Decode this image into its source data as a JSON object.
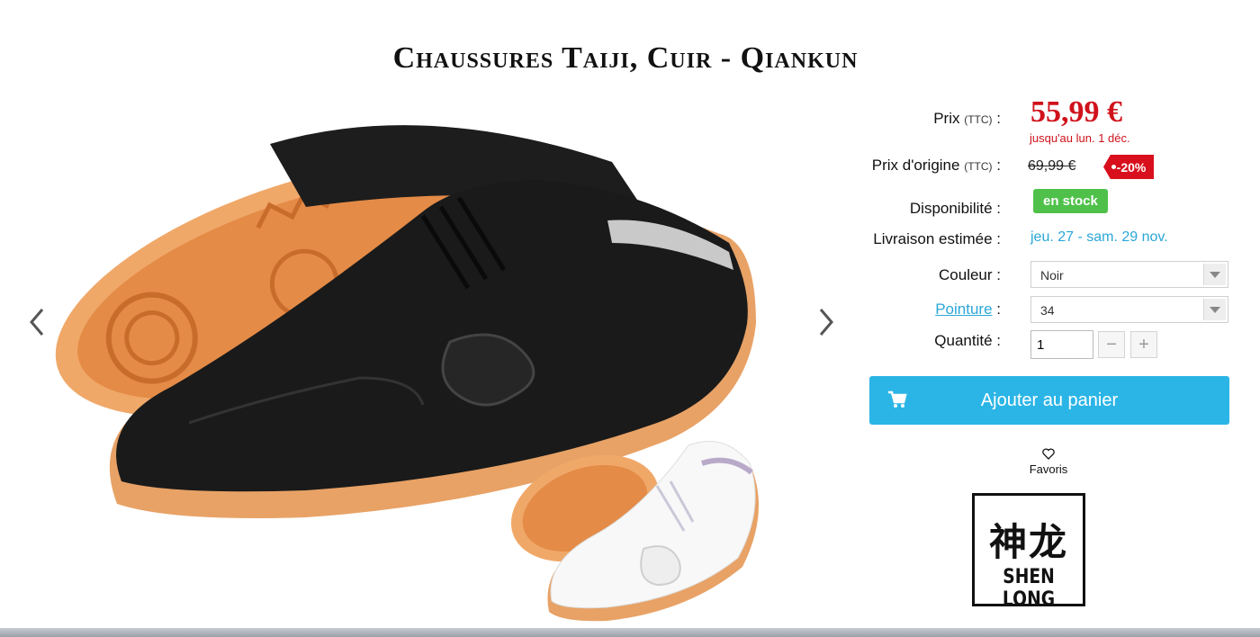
{
  "product": {
    "title": "Chaussures Taiji, Cuir - Qiankun"
  },
  "gallery": {
    "prev_icon": "chevron-left-icon",
    "next_icon": "chevron-right-icon"
  },
  "pricing": {
    "price_label": "Prix",
    "price_tax_note": "(TTC)",
    "price_sep": ":",
    "price": "55,99 €",
    "valid_until": "jusqu'au lun. 1 déc.",
    "original_label": "Prix d'origine",
    "original_tax_note": "(TTC)",
    "original_price": "69,99 €",
    "discount": "-20%",
    "price_color": "#d0121b"
  },
  "availability": {
    "label": "Disponibilité :",
    "value": "en stock",
    "color": "#4fc14a"
  },
  "delivery": {
    "label": "Livraison estimée :",
    "value": "jeu. 27 - sam. 29 nov."
  },
  "options": {
    "color_label": "Couleur :",
    "color_value": "Noir",
    "size_label": "Pointure",
    "size_sep": ":",
    "size_value": "34",
    "qty_label": "Quantité :",
    "qty_value": "1",
    "minus": "−",
    "plus": "+"
  },
  "cart": {
    "button_label": "Ajouter au panier",
    "icon": "cart-icon",
    "color": "#2bb5e6"
  },
  "favorites": {
    "label": "Favoris",
    "icon": "heart-icon"
  },
  "brand": {
    "chinese": "神龙",
    "name": "SHEN LONG"
  }
}
